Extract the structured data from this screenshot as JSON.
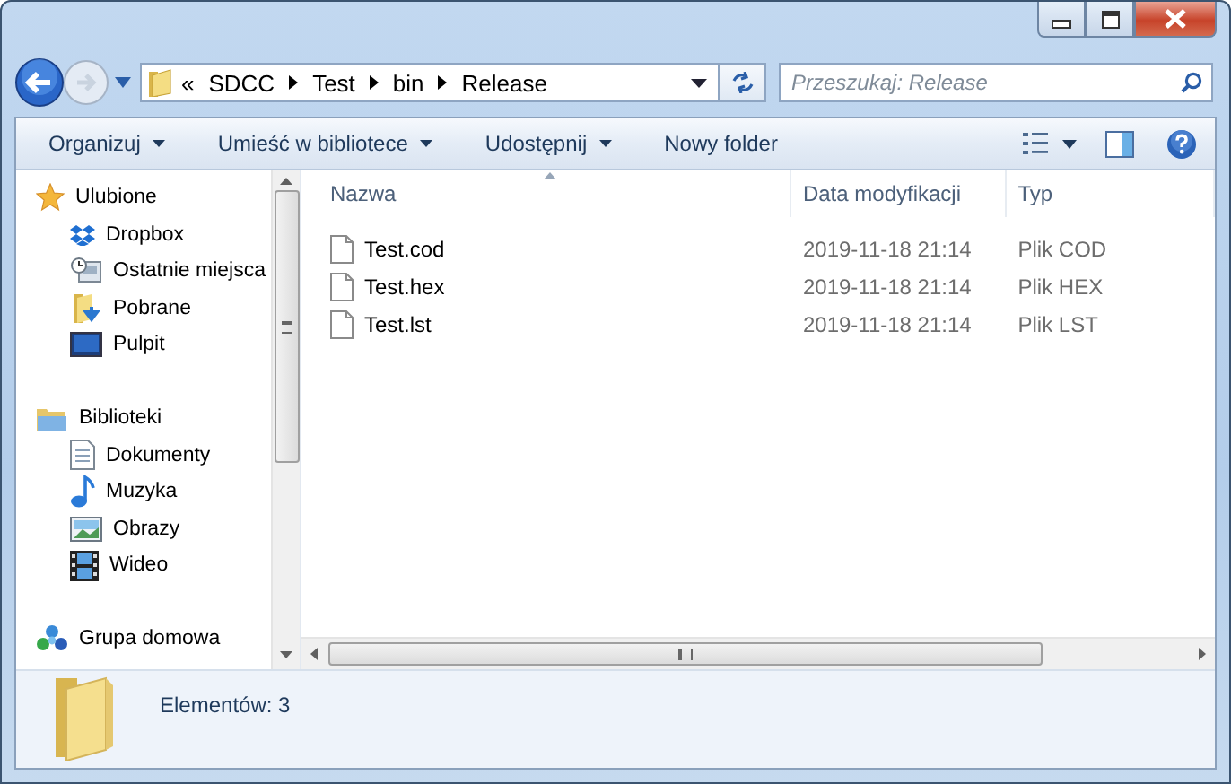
{
  "address_bar": {
    "overflow": "«",
    "crumbs": [
      "SDCC",
      "Test",
      "bin",
      "Release"
    ]
  },
  "search": {
    "placeholder": "Przeszukaj: Release"
  },
  "toolbar": {
    "items": [
      {
        "label": "Organizuj",
        "menu": true
      },
      {
        "label": "Umieść w bibliotece",
        "menu": true
      },
      {
        "label": "Udostępnij",
        "menu": true
      },
      {
        "label": "Nowy folder",
        "menu": false
      }
    ]
  },
  "sidebar": {
    "groups": [
      {
        "label": "Ulubione",
        "children": [
          {
            "label": "Dropbox"
          },
          {
            "label": "Ostatnie miejsca"
          },
          {
            "label": "Pobrane"
          },
          {
            "label": "Pulpit"
          }
        ]
      },
      {
        "label": "Biblioteki",
        "children": [
          {
            "label": "Dokumenty"
          },
          {
            "label": "Muzyka"
          },
          {
            "label": "Obrazy"
          },
          {
            "label": "Wideo"
          }
        ]
      },
      {
        "label": "Grupa domowa"
      }
    ]
  },
  "table": {
    "columns": [
      {
        "label": "Nazwa",
        "sorted": true
      },
      {
        "label": "Data modyfikacji",
        "sorted": false
      },
      {
        "label": "Typ",
        "sorted": false
      }
    ],
    "rows": [
      {
        "name": "Test.cod",
        "modified": "2019-11-18 21:14",
        "type": "Plik COD"
      },
      {
        "name": "Test.hex",
        "modified": "2019-11-18 21:14",
        "type": "Plik HEX"
      },
      {
        "name": "Test.lst",
        "modified": "2019-11-18 21:14",
        "type": "Plik LST"
      }
    ]
  },
  "status_bar": {
    "text": "Elementów: 3"
  }
}
